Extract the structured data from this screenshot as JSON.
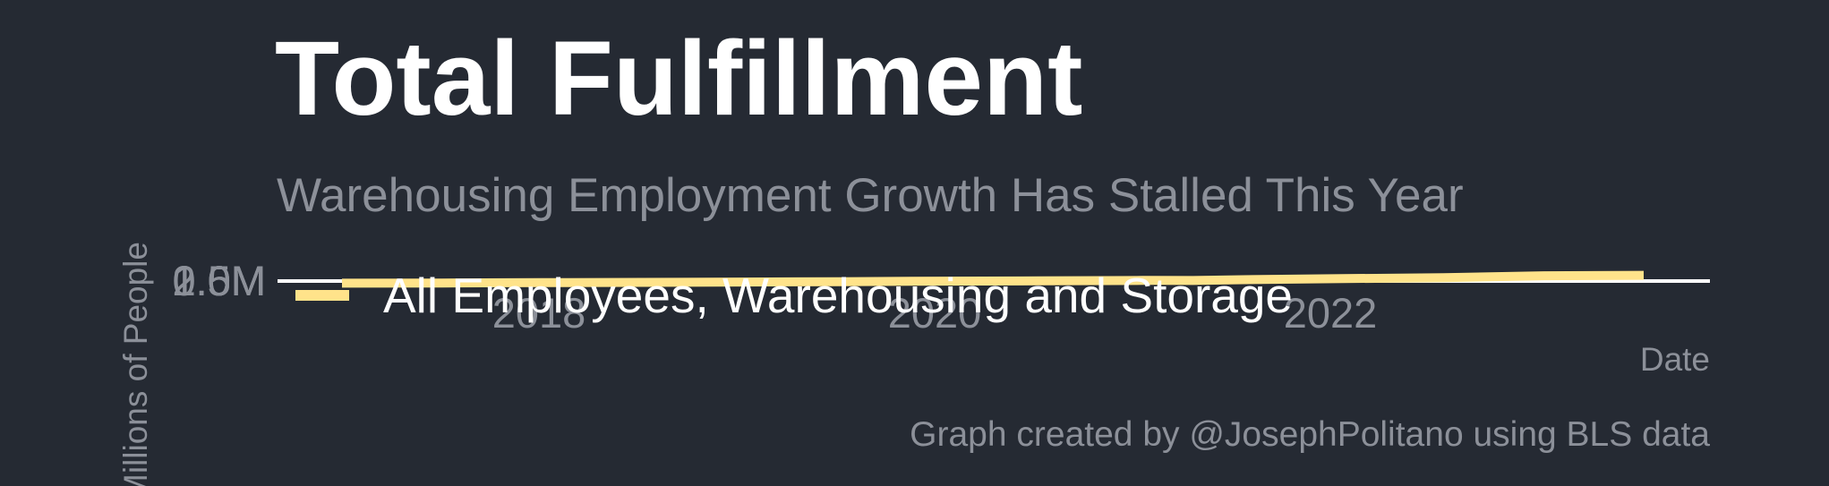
{
  "chart_data": {
    "type": "line",
    "title": "Total Fulfillment",
    "subtitle": "Warehousing Employment Growth Has Stalled This Year",
    "xlabel": "Date",
    "ylabel": "Millions of People",
    "caption": "Graph created by @JosephPolitano using BLS data",
    "y_ticks": [
      "0.5M",
      "1.0M",
      "1.5M",
      "2.0M"
    ],
    "x_ticks": [
      "2018",
      "2020",
      "2022"
    ],
    "series": [
      {
        "name": "All Employees, Warehousing and Storage",
        "color": "#ffe38a",
        "x": [
          "2016-01",
          "2016-07",
          "2017-01",
          "2017-07",
          "2018-01",
          "2018-07",
          "2019-01",
          "2019-07",
          "2020-01",
          "2020-04",
          "2020-07",
          "2021-01",
          "2021-07",
          "2022-01",
          "2022-07"
        ],
        "values": [
          0.84,
          0.86,
          0.89,
          0.92,
          0.96,
          1.0,
          1.05,
          1.08,
          1.13,
          1.12,
          1.2,
          1.32,
          1.42,
          1.62,
          1.66
        ]
      }
    ]
  },
  "colors": {
    "background": "#252a33",
    "title": "#ffffff",
    "muted": "#8c9099",
    "axis": "#ffffff",
    "series": "#ffe38a"
  }
}
